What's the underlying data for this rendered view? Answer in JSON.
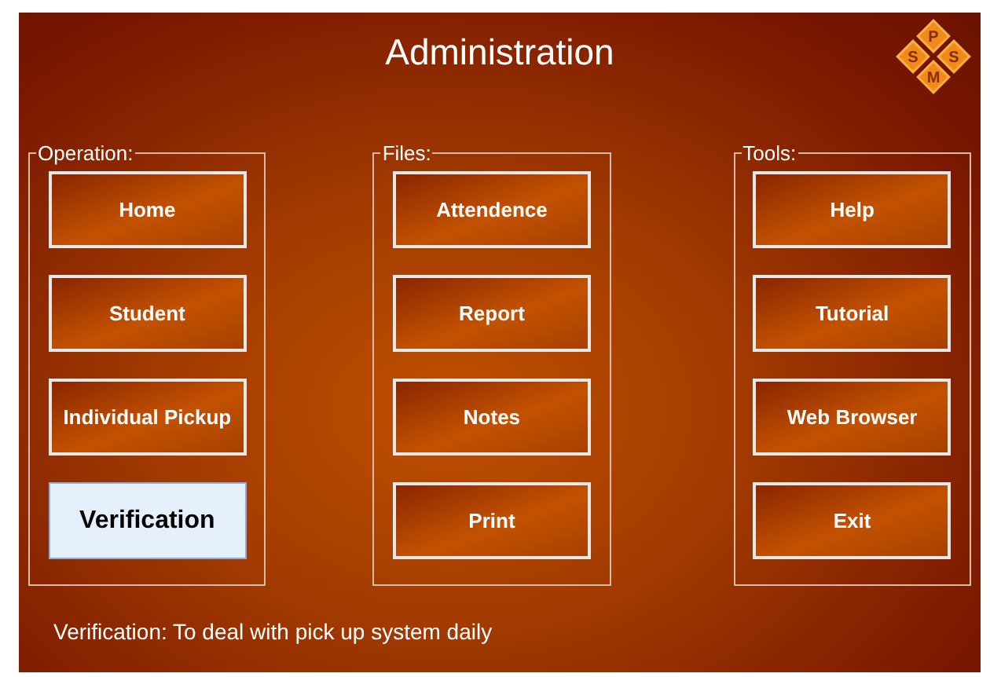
{
  "window": {
    "title": "Administration"
  },
  "logo": {
    "letters": [
      "P",
      "S",
      "S",
      "M"
    ]
  },
  "groups": [
    {
      "label": "Operation:",
      "buttons": [
        {
          "label": "Home",
          "selected": false
        },
        {
          "label": "Student",
          "selected": false
        },
        {
          "label": "Individual Pickup",
          "selected": false
        },
        {
          "label": "Verification",
          "selected": true
        }
      ]
    },
    {
      "label": "Files:",
      "buttons": [
        {
          "label": "Attendence",
          "selected": false
        },
        {
          "label": "Report",
          "selected": false
        },
        {
          "label": "Notes",
          "selected": false
        },
        {
          "label": "Print",
          "selected": false
        }
      ]
    },
    {
      "label": "Tools:",
      "buttons": [
        {
          "label": "Help",
          "selected": false
        },
        {
          "label": "Tutorial",
          "selected": false
        },
        {
          "label": "Web Browser",
          "selected": false
        },
        {
          "label": "Exit",
          "selected": false
        }
      ]
    }
  ],
  "status": "Verification: To deal with pick up system daily"
}
